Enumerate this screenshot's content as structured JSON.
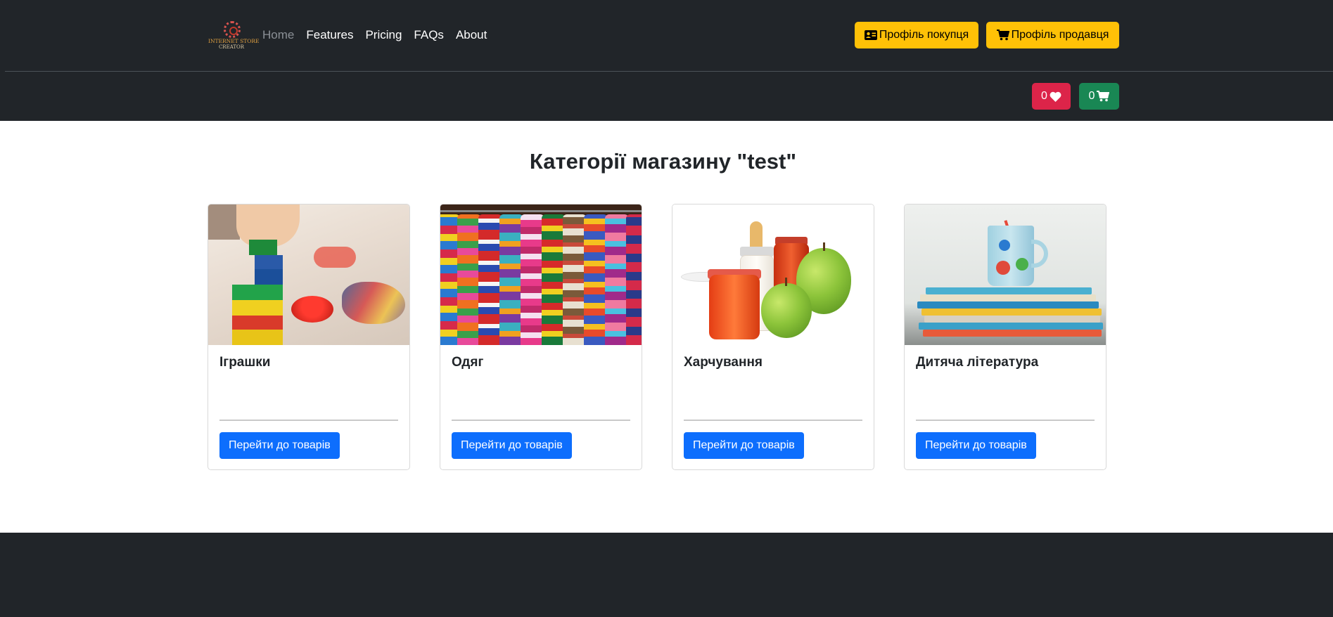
{
  "brand": {
    "line1": "INTERNET STORE",
    "line2": "CREATOR"
  },
  "nav": [
    "Home",
    "Features",
    "Pricing",
    "FAQs",
    "About"
  ],
  "header_buttons": {
    "buyer_profile": "Профіль покупця",
    "seller_profile": "Профіль продавця"
  },
  "counters": {
    "favorites": "0",
    "cart": "0"
  },
  "page_title": "Категорії магазину \"test\"",
  "categories": [
    {
      "title": "Іграшки",
      "button": "Перейти до товарів",
      "image": "toy-blocks-photo"
    },
    {
      "title": "Одяг",
      "button": "Перейти до товарів",
      "image": "clothes-rack-photo"
    },
    {
      "title": "Харчування",
      "button": "Перейти до товарів",
      "image": "baby-food-photo"
    },
    {
      "title": "Дитяча література",
      "button": "Перейти до товарів",
      "image": "children-books-photo"
    }
  ],
  "colors": {
    "header_bg": "#212529",
    "warning": "#ffc107",
    "danger": "#dc2449",
    "success": "#198754",
    "primary": "#0d6efd"
  },
  "icons": [
    "id-card-icon",
    "cart-icon",
    "heart-icon"
  ]
}
